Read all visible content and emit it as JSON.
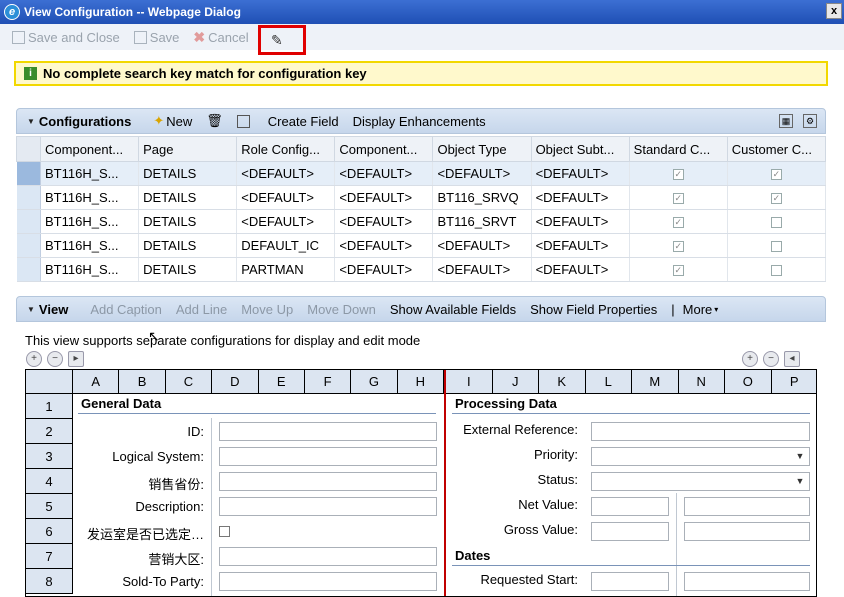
{
  "window": {
    "title": "View Configuration -- Webpage Dialog",
    "close_label": "x"
  },
  "toolbar": {
    "save_close": "Save and Close",
    "save": "Save",
    "cancel": "Cancel"
  },
  "message": {
    "text": "No complete search key match for configuration key"
  },
  "configurations": {
    "title": "Configurations",
    "actions": {
      "new": "New",
      "create_field": "Create Field",
      "display_enhancements": "Display Enhancements"
    },
    "columns": [
      "Component...",
      "Page",
      "Role Config...",
      "Component...",
      "Object Type",
      "Object Subt...",
      "Standard C...",
      "Customer C..."
    ],
    "rows": [
      {
        "cells": [
          "BT116H_S...",
          "DETAILS",
          "<DEFAULT>",
          "<DEFAULT>",
          "<DEFAULT>",
          "<DEFAULT>"
        ],
        "standard": true,
        "customer": true
      },
      {
        "cells": [
          "BT116H_S...",
          "DETAILS",
          "<DEFAULT>",
          "<DEFAULT>",
          "BT116_SRVQ",
          "<DEFAULT>"
        ],
        "standard": true,
        "customer": true
      },
      {
        "cells": [
          "BT116H_S...",
          "DETAILS",
          "<DEFAULT>",
          "<DEFAULT>",
          "BT116_SRVT",
          "<DEFAULT>"
        ],
        "standard": true,
        "customer": false
      },
      {
        "cells": [
          "BT116H_S...",
          "DETAILS",
          "DEFAULT_IC",
          "<DEFAULT>",
          "<DEFAULT>",
          "<DEFAULT>"
        ],
        "standard": true,
        "customer": false
      },
      {
        "cells": [
          "BT116H_S...",
          "DETAILS",
          "PARTMAN",
          "<DEFAULT>",
          "<DEFAULT>",
          "<DEFAULT>"
        ],
        "standard": true,
        "customer": false
      }
    ]
  },
  "view": {
    "title": "View",
    "actions": {
      "add_caption": "Add Caption",
      "add_line": "Add Line",
      "move_up": "Move Up",
      "move_down": "Move Down",
      "show_available": "Show Available Fields",
      "show_props": "Show Field Properties",
      "more": "More"
    },
    "info": "This view supports separate configurations for display and edit mode",
    "col_letters": [
      "A",
      "B",
      "C",
      "D",
      "E",
      "F",
      "G",
      "H",
      "I",
      "J",
      "K",
      "L",
      "M",
      "N",
      "O",
      "P"
    ],
    "row_numbers": [
      "1",
      "2",
      "3",
      "4",
      "5",
      "6",
      "7",
      "8"
    ],
    "left_section": "General Data",
    "right_section": "Processing Data",
    "dates_section": "Dates",
    "left_labels": [
      "ID:",
      "Logical System:",
      "销售省份:",
      "Description:",
      "发运室是否已选定…",
      "营销大区:",
      "Sold-To Party:"
    ],
    "right_labels": [
      "External Reference:",
      "Priority:",
      "Status:",
      "Net Value:",
      "Gross Value:",
      "Requested Start:"
    ]
  }
}
